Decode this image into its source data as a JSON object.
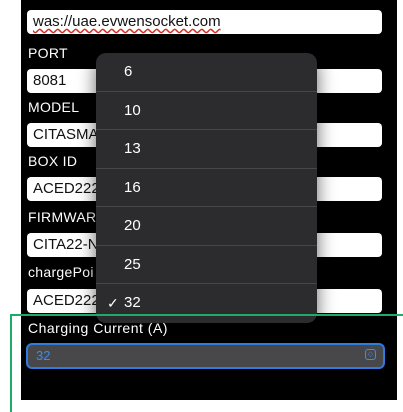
{
  "fields": [
    {
      "label": "",
      "value_error": "was://uae.evwensocket.com"
    },
    {
      "label": "PORT",
      "value": "8081"
    },
    {
      "label": "MODEL",
      "value": "CITASMAI"
    },
    {
      "label": "BOX ID",
      "value": "ACED222"
    },
    {
      "label": "FIRMWAR",
      "value": "CITA22-N"
    },
    {
      "label": "chargePoi",
      "value": "ACED222"
    }
  ],
  "dropdown": {
    "options": [
      "6",
      "10",
      "13",
      "16",
      "20",
      "25",
      "32"
    ],
    "selected": "32",
    "check_icon": "checkmark-icon"
  },
  "charging_current": {
    "label": "Charging Current (A)",
    "value": "32",
    "chevron_icon": "chevron-updown-icon"
  },
  "colors": {
    "background": "#000000",
    "dropdown": "#2c2c2e",
    "accent": "#2f7be0",
    "guide": "#1faa6a"
  }
}
